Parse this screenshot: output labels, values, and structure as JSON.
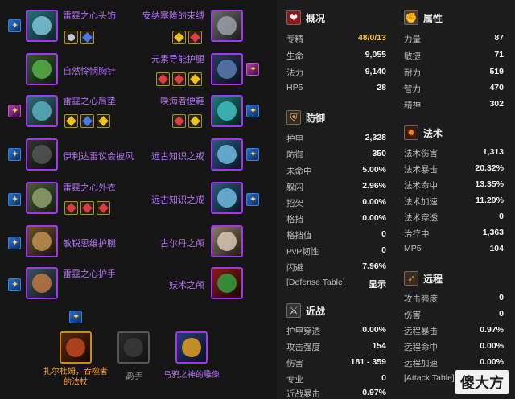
{
  "equipment": {
    "left": [
      {
        "name": "雷霆之心头饰",
        "gems": [
          "meta",
          "blue"
        ],
        "enchant": true
      },
      {
        "name": "自然怜悯胸针",
        "gems": [],
        "enchant": false
      },
      {
        "name": "雷霆之心肩垫",
        "gems": [
          "yellow",
          "blue",
          "yellow"
        ],
        "enchant": true
      },
      {
        "name": "伊利达雷议会披风",
        "gems": [],
        "enchant": true
      },
      {
        "name": "雷霆之心外衣",
        "gems": [
          "red",
          "red",
          "red"
        ],
        "enchant": true
      },
      {
        "name": "敏锐思维护腕",
        "gems": [],
        "enchant": true
      },
      {
        "name": "雷霆之心护手",
        "gems": [],
        "enchant": true
      }
    ],
    "right": [
      {
        "name": "安纳塞隆的束缚",
        "gems": [
          "yellow",
          "red"
        ],
        "enchant": false
      },
      {
        "name": "元素导能护腿",
        "gems": [
          "red",
          "red",
          "yellow"
        ],
        "enchant": true
      },
      {
        "name": "唤海者便鞋",
        "gems": [
          "red",
          "yellow"
        ],
        "enchant": true
      },
      {
        "name": "远古知识之戒",
        "gems": [],
        "enchant": true
      },
      {
        "name": "远古知识之戒",
        "gems": [],
        "enchant": true
      },
      {
        "name": "古尔丹之颅",
        "gems": [],
        "enchant": false
      },
      {
        "name": "妖术之颅",
        "gems": [],
        "enchant": false
      }
    ],
    "bottom": [
      {
        "name": "扎尔杜姆，吞噬者的法杖",
        "color": "#ff9a1e"
      },
      {
        "name": "副手",
        "color": "#9e9e9e"
      },
      {
        "name": "乌鸦之神的雕像",
        "color": "#b26ef2"
      }
    ]
  },
  "panels": {
    "overview": {
      "title": "概况",
      "rows": [
        {
          "label": "专精",
          "value": "48/0/13",
          "highlight": true
        },
        {
          "label": "生命",
          "value": "9,055"
        },
        {
          "label": "法力",
          "value": "9,140"
        },
        {
          "label": "HP5",
          "value": "28"
        }
      ]
    },
    "attributes": {
      "title": "属性",
      "rows": [
        {
          "label": "力量",
          "value": "87"
        },
        {
          "label": "敏捷",
          "value": "71"
        },
        {
          "label": "耐力",
          "value": "519"
        },
        {
          "label": "智力",
          "value": "470"
        },
        {
          "label": "精神",
          "value": "302"
        }
      ]
    },
    "defense": {
      "title": "防御",
      "rows": [
        {
          "label": "护甲",
          "value": "2,328"
        },
        {
          "label": "防御",
          "value": "350"
        },
        {
          "label": "未命中",
          "value": "5.00%"
        },
        {
          "label": "躲闪",
          "value": "2.96%"
        },
        {
          "label": "招架",
          "value": "0.00%"
        },
        {
          "label": "格挡",
          "value": "0.00%"
        },
        {
          "label": "格挡值",
          "value": "0"
        },
        {
          "label": "PvP韧性",
          "value": "0"
        },
        {
          "label": "闪避",
          "value": "7.96%"
        }
      ],
      "table_label": "[Defense Table]",
      "show_label": "显示"
    },
    "spell": {
      "title": "法术",
      "rows": [
        {
          "label": "法术伤害",
          "value": "1,313"
        },
        {
          "label": "法术暴击",
          "value": "20.32%"
        },
        {
          "label": "法术命中",
          "value": "13.35%"
        },
        {
          "label": "法术加速",
          "value": "11.29%"
        },
        {
          "label": "法术穿透",
          "value": "0"
        },
        {
          "label": "治疗中",
          "value": "1,363"
        },
        {
          "label": "MP5",
          "value": "104"
        }
      ]
    },
    "melee": {
      "title": "近战",
      "rows": [
        {
          "label": "护甲穿透",
          "value": "0.00%"
        },
        {
          "label": "攻击强度",
          "value": "154"
        },
        {
          "label": "伤害",
          "value": "181 - 359"
        },
        {
          "label": "专业",
          "value": "0"
        },
        {
          "label": "近战暴击",
          "value": "0.97%"
        }
      ]
    },
    "ranged": {
      "title": "远程",
      "rows": [
        {
          "label": "攻击强度",
          "value": "0"
        },
        {
          "label": "伤害",
          "value": "0"
        },
        {
          "label": "远程暴击",
          "value": "0.97%"
        },
        {
          "label": "远程命中",
          "value": "0.00%"
        },
        {
          "label": "远程加速",
          "value": "0.00%"
        }
      ],
      "table_label": "[Attack Table]",
      "show_label": "显示"
    }
  },
  "watermark": "傻大方",
  "colors": {
    "epic": "#b26ef2",
    "legendary": "#ff9a1e",
    "highlight": "#f4c430"
  }
}
